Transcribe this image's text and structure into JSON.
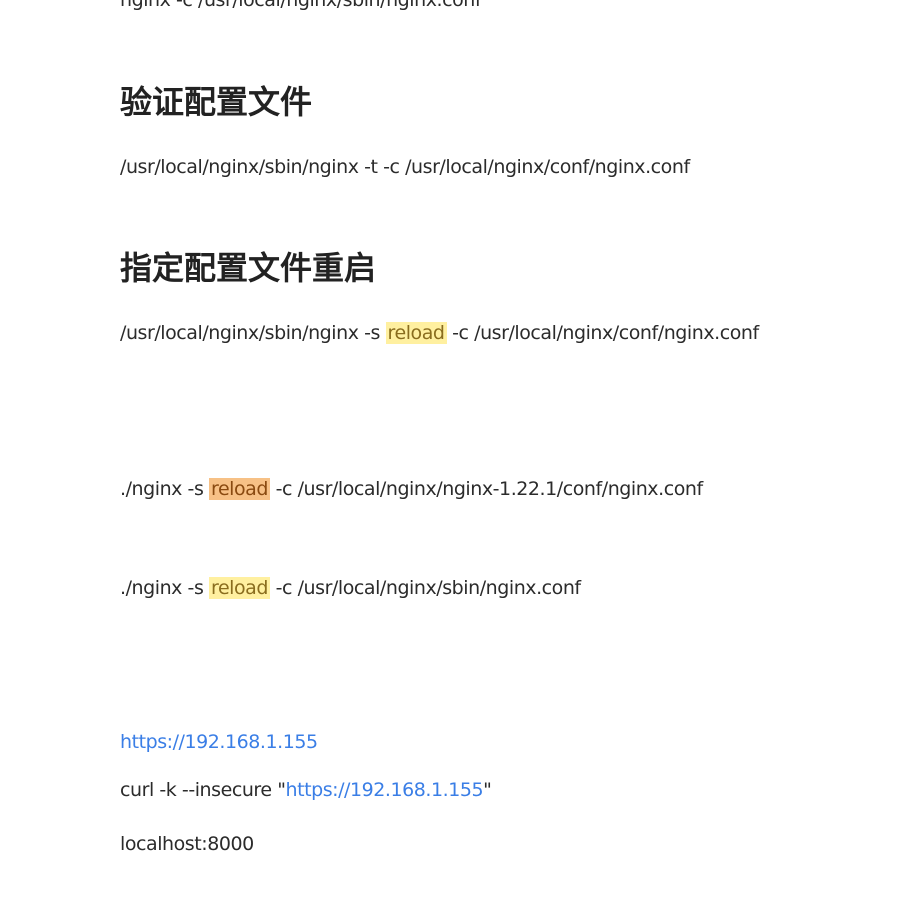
{
  "lines": {
    "cut_off": "nginx -c   /usr/local/nginx/sbin/nginx.conf",
    "verify_cmd": "/usr/local/nginx/sbin/nginx -t -c /usr/local/nginx/conf/nginx.conf",
    "reload_a_pre": "/usr/local/nginx/sbin/nginx -s ",
    "reload_a_hl": "reload",
    "reload_a_post": " -c /usr/local/nginx/conf/nginx.conf",
    "reload_b_pre": "./nginx  -s ",
    "reload_b_hl": "reload",
    "reload_b_post": " -c  /usr/local/nginx/nginx-1.22.1/conf/nginx.conf",
    "reload_c_pre": "./nginx  -s ",
    "reload_c_hl": "reload",
    "reload_c_post": " -c  /usr/local/nginx/sbin/nginx.conf",
    "url": "https://192.168.1.155",
    "curl_pre": "curl -k --insecure \"",
    "curl_link": "https://192.168.1.155",
    "curl_post": "\"",
    "localhost": "localhost:8000"
  },
  "headings": {
    "verify": "验证配置文件",
    "restart": "指定配置文件重启"
  },
  "colors": {
    "text": "#2b2b2b",
    "link": "#3a7ee6",
    "highlight": "#fff0a0",
    "highlight_active": "#f7c186"
  }
}
